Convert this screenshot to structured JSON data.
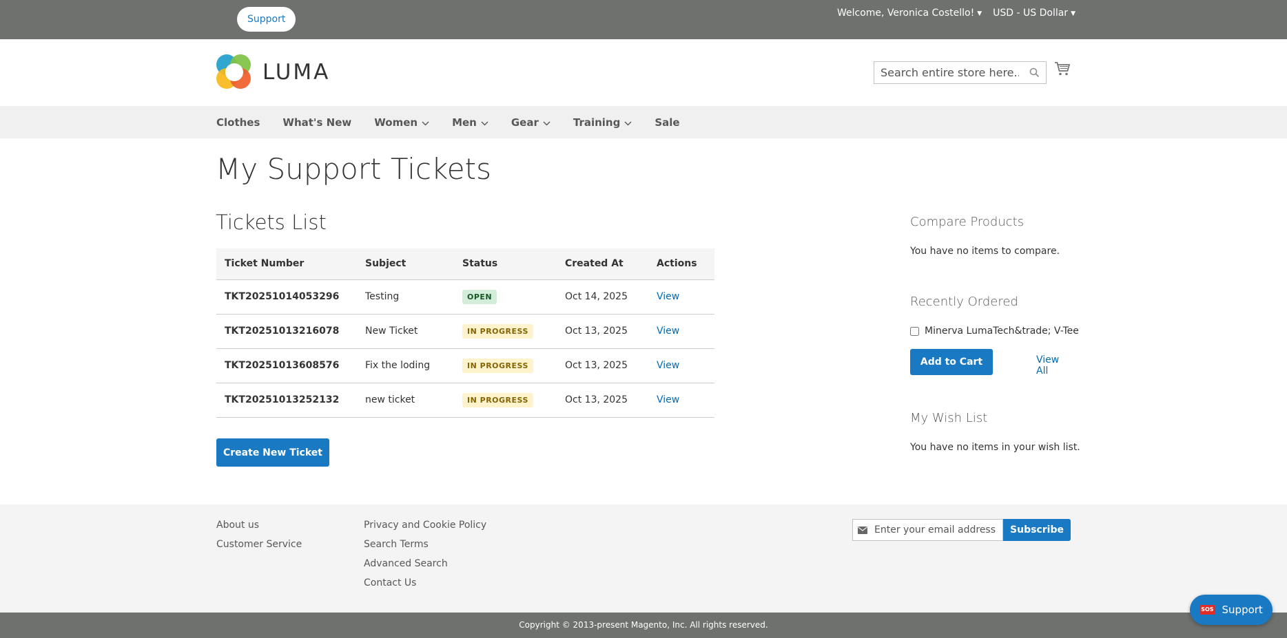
{
  "topbar": {
    "support_label": "Support",
    "welcome": "Welcome, Veronica Costello!",
    "currency": "USD - US Dollar"
  },
  "header": {
    "logo_text": "LUMA",
    "search_placeholder": "Search entire store here..."
  },
  "nav": {
    "items": [
      {
        "label": "Clothes",
        "has_dropdown": false
      },
      {
        "label": "What's New",
        "has_dropdown": false
      },
      {
        "label": "Women",
        "has_dropdown": true
      },
      {
        "label": "Men",
        "has_dropdown": true
      },
      {
        "label": "Gear",
        "has_dropdown": true
      },
      {
        "label": "Training",
        "has_dropdown": true
      },
      {
        "label": "Sale",
        "has_dropdown": false
      }
    ]
  },
  "main": {
    "page_title": "My Support Tickets",
    "section_title": "Tickets List",
    "columns": [
      "Ticket Number",
      "Subject",
      "Status",
      "Created At",
      "Actions"
    ],
    "tickets": [
      {
        "number": "TKT20251014053296",
        "subject": "Testing",
        "status": "OPEN",
        "created": "Oct 14, 2025",
        "action": "View"
      },
      {
        "number": "TKT20251013216078",
        "subject": "New Ticket",
        "status": "IN PROGRESS",
        "created": "Oct 13, 2025",
        "action": "View"
      },
      {
        "number": "TKT20251013608576",
        "subject": "Fix the loding",
        "status": "IN PROGRESS",
        "created": "Oct 13, 2025",
        "action": "View"
      },
      {
        "number": "TKT20251013252132",
        "subject": "new ticket",
        "status": "IN PROGRESS",
        "created": "Oct 13, 2025",
        "action": "View"
      }
    ],
    "create_button": "Create New Ticket"
  },
  "sidebar": {
    "compare_title": "Compare Products",
    "compare_text": "You have no items to compare.",
    "recent_title": "Recently Ordered",
    "recent_item": "Minerva LumaTech&trade; V-Tee",
    "add_to_cart": "Add to Cart",
    "view_all": "View All",
    "wishlist_title": "My Wish List",
    "wishlist_text": "You have no items in your wish list."
  },
  "footer": {
    "col1": [
      "About us",
      "Customer Service"
    ],
    "col2": [
      "Privacy and Cookie Policy",
      "Search Terms",
      "Advanced Search",
      "Contact Us"
    ],
    "email_placeholder": "Enter your email address",
    "subscribe": "Subscribe",
    "copyright": "Copyright © 2013-present Magento, Inc. All rights reserved."
  },
  "float_support": {
    "sos": "SOS",
    "label": "Support"
  },
  "colors": {
    "accent": "#1979c3",
    "topbar": "#6e716e",
    "open_badge_bg": "#d4edda",
    "progress_badge_bg": "#fff3cd"
  }
}
